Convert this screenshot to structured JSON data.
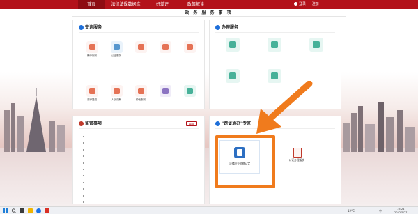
{
  "colors": {
    "nav_red": "#b3121a",
    "highlight_orange": "#f07b1d",
    "accent_blue": "#1e6fd9"
  },
  "nav": {
    "items": [
      "首页",
      "法律法规数据库",
      "好差评",
      "政策解读"
    ],
    "login_label": "登录",
    "register_label": "注册"
  },
  "page_title": "政 务 服 务 事 项",
  "query": {
    "title": "查询服务",
    "tiles": [
      {
        "label": "律师服务",
        "icon": "lawyer-icon"
      },
      {
        "label": "公证服务",
        "icon": "notary-icon"
      },
      {
        "label": "",
        "icon": "judicial-icon"
      },
      {
        "label": "",
        "icon": "exam-icon"
      },
      {
        "label": "",
        "icon": "appraisal-icon"
      },
      {
        "label": "法律援助",
        "icon": "legal-aid-icon"
      },
      {
        "label": "人民调解",
        "icon": "mediation-icon"
      },
      {
        "label": "仲裁服务",
        "icon": "arbitration-icon"
      },
      {
        "label": "",
        "icon": "hongkong-icon"
      },
      {
        "label": "",
        "icon": "taiwan-icon"
      }
    ]
  },
  "handle": {
    "title": "办理服务",
    "tiles": [
      {
        "label": "",
        "icon": "doc-icon"
      },
      {
        "label": "",
        "icon": "doc-icon"
      },
      {
        "label": "",
        "icon": "doc-icon"
      },
      {
        "label": "",
        "icon": "doc-icon"
      },
      {
        "label": "",
        "icon": "doc-icon"
      }
    ]
  },
  "supervise": {
    "title": "监管事项",
    "more_label": "更多",
    "items": [
      "",
      "",
      "",
      "",
      "",
      "",
      "",
      "",
      "",
      "",
      "",
      "",
      ""
    ]
  },
  "crossprov": {
    "title": "\"跨省通办\"专区",
    "tiles": [
      {
        "label": "法律职业资格认定",
        "icon": "certificate-icon"
      },
      {
        "label": "公证办理服务",
        "icon": "scale-icon"
      }
    ]
  },
  "taskbar": {
    "weather": "12°C",
    "ime": "中",
    "time": "15:24",
    "date": "2022/5/27"
  }
}
